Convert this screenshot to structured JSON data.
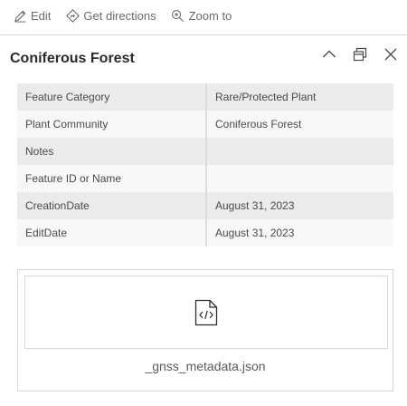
{
  "toolbar": {
    "edit_label": "Edit",
    "directions_label": "Get directions",
    "zoom_label": "Zoom to"
  },
  "feature": {
    "title": "Coniferous Forest"
  },
  "attributes": [
    {
      "key": "Feature Category",
      "value": "Rare/Protected Plant"
    },
    {
      "key": "Plant Community",
      "value": "Coniferous Forest"
    },
    {
      "key": "Notes",
      "value": ""
    },
    {
      "key": "Feature ID or Name",
      "value": ""
    },
    {
      "key": "CreationDate",
      "value": "August 31, 2023"
    },
    {
      "key": "EditDate",
      "value": "August 31, 2023"
    }
  ],
  "attachment": {
    "filename": "_gnss_metadata.json",
    "icon": "code-file-icon"
  },
  "icons": {
    "edit": "edit-icon",
    "directions": "directions-icon",
    "zoom": "zoom-icon",
    "collapse": "chevron-up-icon",
    "dock": "dock-icon",
    "close": "close-icon"
  }
}
